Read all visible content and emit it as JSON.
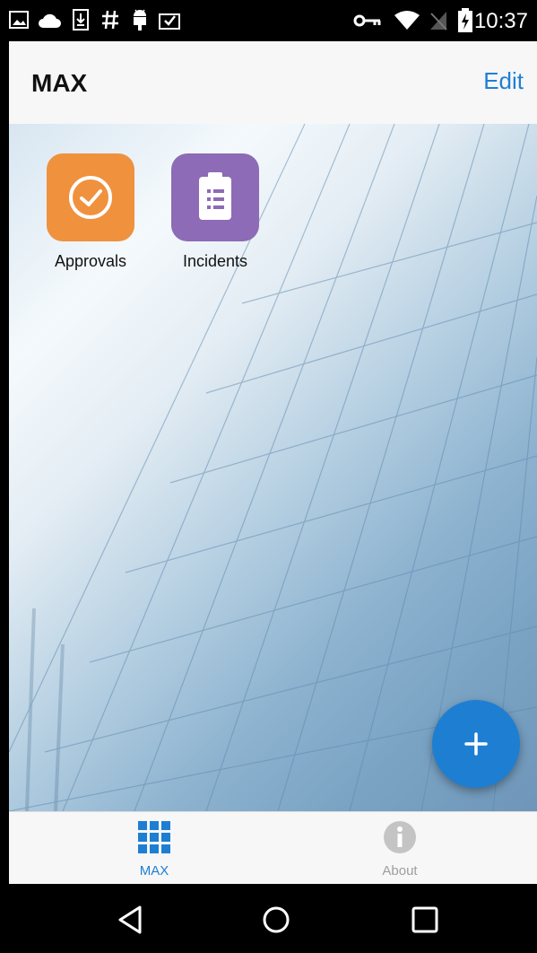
{
  "status_bar": {
    "time": "10:37",
    "left_icons": [
      "image-icon",
      "cloud-icon",
      "download-icon",
      "hash-icon",
      "android-icon",
      "clipboard-check-icon"
    ],
    "right_icons": [
      "key-icon",
      "wifi-icon",
      "no-sim-icon",
      "battery-charging-icon"
    ]
  },
  "header": {
    "title": "MAX",
    "edit_label": "Edit",
    "accent_color": "#1f7fd6"
  },
  "apps": [
    {
      "label": "Approvals",
      "icon": "check-circle-icon",
      "color": "#f0913e"
    },
    {
      "label": "Incidents",
      "icon": "clipboard-list-icon",
      "color": "#8d6bb6"
    }
  ],
  "fab": {
    "icon": "plus-icon",
    "color": "#1e7fd2"
  },
  "tabs": [
    {
      "label": "MAX",
      "icon": "grid-icon",
      "active": true,
      "color": "#1e7fd2"
    },
    {
      "label": "About",
      "icon": "info-icon",
      "active": false,
      "color": "#9e9e9e"
    }
  ],
  "nav_bar": {
    "buttons": [
      "back-icon",
      "home-icon",
      "recents-icon"
    ]
  }
}
